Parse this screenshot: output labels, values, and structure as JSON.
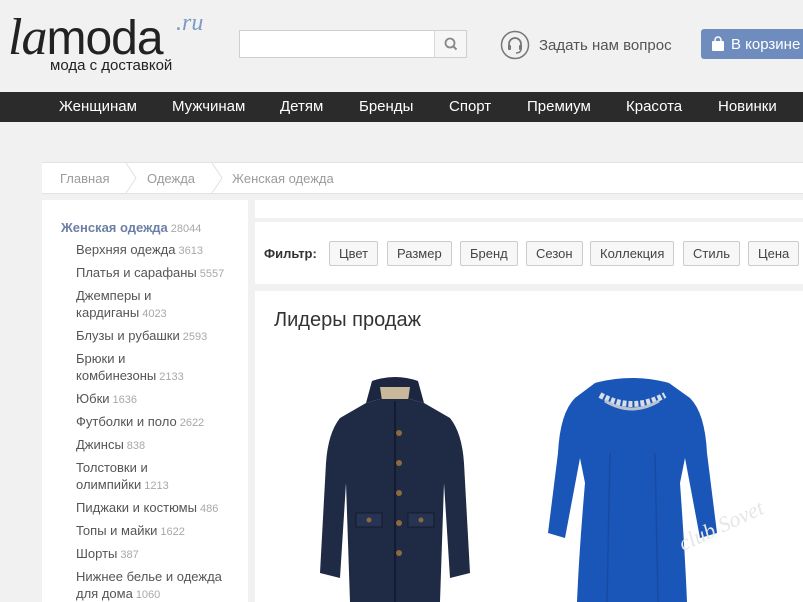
{
  "logo": {
    "la": "la",
    "moda": "moda",
    "ru": ".ru",
    "tagline": "мода с доставкой"
  },
  "search": {
    "value": "",
    "placeholder": ""
  },
  "help": {
    "label": "Задать нам вопрос"
  },
  "cart": {
    "label": "В корзине"
  },
  "nav": [
    "Женщинам",
    "Мужчинам",
    "Детям",
    "Бренды",
    "Спорт",
    "Премиум",
    "Красота",
    "Новинки"
  ],
  "breadcrumbs": [
    "Главная",
    "Одежда",
    "Женская одежда"
  ],
  "sidebar": {
    "title": {
      "label": "Женская одежда",
      "count": "28044"
    },
    "items": [
      {
        "label": "Верхняя одежда",
        "count": "3613"
      },
      {
        "label": "Платья и сарафаны",
        "count": "5557"
      },
      {
        "label": "Джемперы и кардиганы",
        "count": "4023"
      },
      {
        "label": "Блузы и рубашки",
        "count": "2593"
      },
      {
        "label": "Брюки и комбинезоны",
        "count": "2133"
      },
      {
        "label": "Юбки",
        "count": "1636"
      },
      {
        "label": "Футболки и поло",
        "count": "2622"
      },
      {
        "label": "Джинсы",
        "count": "838"
      },
      {
        "label": "Толстовки и олимпийки",
        "count": "1213"
      },
      {
        "label": "Пиджаки и костюмы",
        "count": "486"
      },
      {
        "label": "Топы и майки",
        "count": "1622"
      },
      {
        "label": "Шорты",
        "count": "387"
      },
      {
        "label": "Нижнее белье и одежда для дома",
        "count": "1060"
      }
    ]
  },
  "filter": {
    "label": "Фильтр:",
    "buttons": [
      "Цвет",
      "Размер",
      "Бренд",
      "Сезон",
      "Коллекция",
      "Стиль",
      "Цена"
    ]
  },
  "leaders": {
    "title": "Лидеры продаж"
  },
  "products": [
    {
      "name": "navy-parka",
      "color": "#1f2a44"
    },
    {
      "name": "blue-dress",
      "color": "#1a56b8"
    }
  ],
  "watermark": {
    "text": "club Sovet"
  },
  "colors": {
    "nav_bg": "#2b2b2b",
    "cart_bg": "#6e8cbd",
    "sidebar_title": "#6d7fa5",
    "page_bg": "#f1f1f1"
  }
}
